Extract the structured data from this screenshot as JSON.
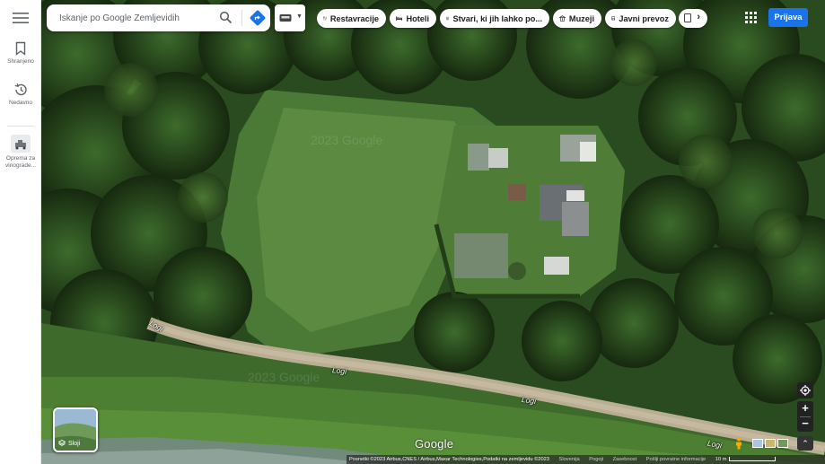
{
  "rail": {
    "saved_label": "Shranjeno",
    "recent_label": "Nedavno",
    "equipment_label": "Oprema za vinograde..."
  },
  "search": {
    "placeholder": "Iskanje po Google Zemljevidih"
  },
  "chips": [
    {
      "label": "Restavracije",
      "icon": "fork-knife-icon"
    },
    {
      "label": "Hoteli",
      "icon": "bed-icon"
    },
    {
      "label": "Stvari, ki jih lahko po...",
      "icon": "camera-icon"
    },
    {
      "label": "Muzeji",
      "icon": "museum-icon"
    },
    {
      "label": "Javni prevoz",
      "icon": "bus-icon"
    }
  ],
  "header": {
    "signin_label": "Prijava"
  },
  "map": {
    "road_label": "Logi",
    "watermark": "2023 Google",
    "logo": "Google",
    "layers_label": "Sloji"
  },
  "footer": {
    "attribution": "Posnetki ©2023 Airbus,CNES / Airbus,Maxar Technologies,Podatki na zemljevidu ©2023",
    "country": "Slovenija",
    "terms": "Pogoji",
    "privacy": "Zasebnost",
    "feedback": "Pošlji povratne informacije",
    "scale_label": "10 m"
  },
  "colors": {
    "accent": "#1a73e8",
    "signin_bg": "#1a73e8"
  }
}
